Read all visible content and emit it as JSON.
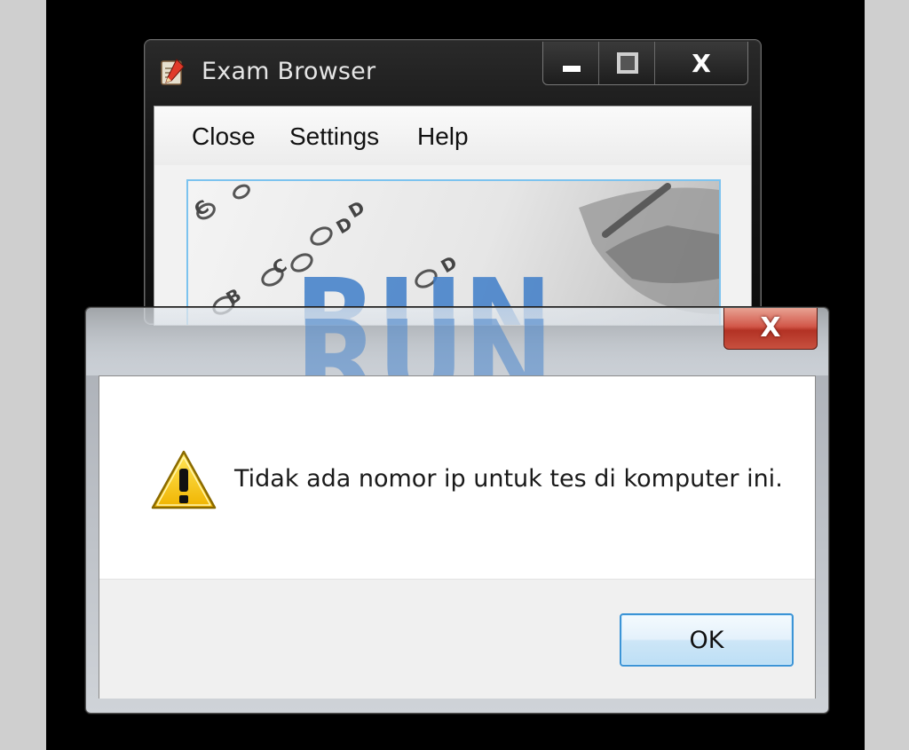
{
  "main_window": {
    "title": "Exam Browser",
    "app_icon": "exam-pencil-icon",
    "caption_buttons": [
      "minimize-icon",
      "maximize-icon",
      "close-icon"
    ],
    "close_glyph": "X",
    "menu": [
      {
        "label": "Close"
      },
      {
        "label": "Settings"
      },
      {
        "label": "Help"
      }
    ],
    "banner": {
      "text": "RUN",
      "bubble_labels": [
        "C",
        "D",
        "C",
        "D",
        "B",
        "D"
      ]
    }
  },
  "dialog": {
    "close_glyph": "X",
    "icon": "warning-icon",
    "message": "Tidak ada nomor ip untuk tes di komputer ini.",
    "ok_label": "OK"
  },
  "colors": {
    "desktop": "#000000",
    "button_border_accent": "#3c94d6",
    "dialog_close": "#c7503f",
    "warning_yellow": "#f5c400",
    "banner_text": "#3f7ec9"
  }
}
